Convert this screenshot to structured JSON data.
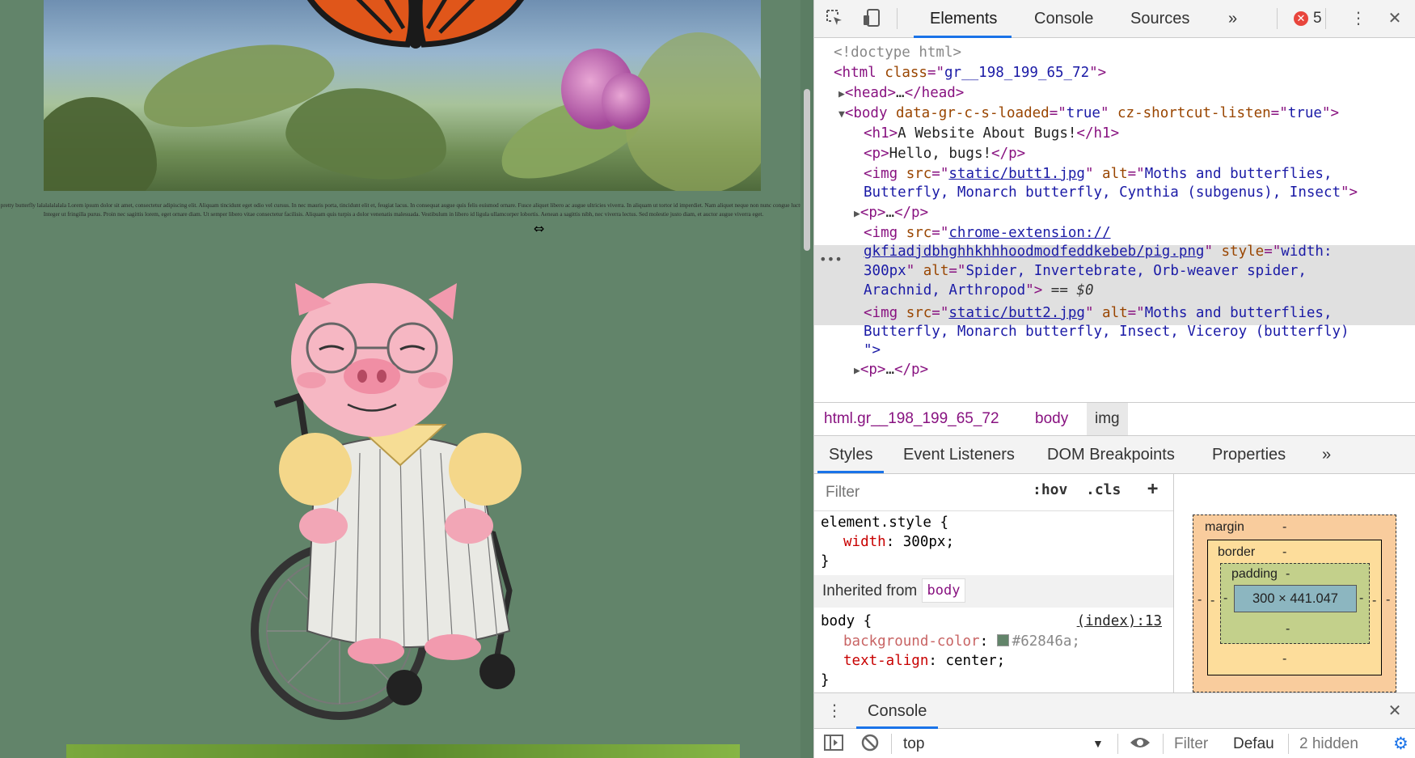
{
  "page": {
    "lorem_text": "pretty butterfly lalalalalalala Lorem ipsum dolor sit amet, consectetur adipiscing elit. Aliquam tincidunt eget odio vel cursus. In nec mauris porta, tincidunt elit et, feugiat lacus. In consequat augue quis felis euismod ornare. Fusce aliquet libero ac augue ultricies viverra. In aliquam ut tortor id imperdiet. Nam aliquet neque non nunc congue luctus. Integer ut fringilla purus. Proin nec sagittis lorem, eget ornare diam. Ut semper libero vitae consectetur facilisis. Aliquam quis turpis a dolor venenatis malesuada. Vestibulum in libero id ligula ullamcorper lobortis. Aenean a sagittis nibh, nec viverra lectus. Sed molestie justo diam, et auctor augue viverra eget.",
    "background_color": "#62846a"
  },
  "devtools": {
    "toolbar": {
      "tabs": [
        "Elements",
        "Console",
        "Sources"
      ],
      "more": "»",
      "error_count": "5",
      "menu_icon": "kebab-icon",
      "close_icon": "close-icon"
    },
    "dom_tree": {
      "doctype": "<!doctype html>",
      "html_tag": "html",
      "html_class_attr": "class",
      "html_class_val": "gr__198_199_65_72",
      "head_text": "…",
      "body_attr1": "data-gr-c-s-loaded",
      "body_attr1_val": "true",
      "body_attr2": "cz-shortcut-listen",
      "body_attr2_val": "true",
      "h1_text": "A Website About Bugs!",
      "p_text": "Hello, bugs!",
      "img1_src": "static/butt1.jpg",
      "img1_alt_line1": "Moths and butterflies,",
      "img1_alt_line2": "Butterfly, Monarch butterfly, Cynthia (subgenus), Insect",
      "p_collapsed": "…",
      "img2_src_line1": "chrome-extension://",
      "img2_src_line2": "gkfiadjdbhghhkhhhoodmodfeddkebeb/pig.png",
      "img2_style": "width:",
      "img2_style2": "300px",
      "img2_alt_line1": "Spider, Invertebrate, Orb-weaver spider,",
      "img2_alt_line2": "Arachnid, Arthropod",
      "selected_marker": "== $0",
      "img3_src": "static/butt2.jpg",
      "img3_alt_line1": "Moths and butterflies,",
      "img3_alt_line2": "Butterfly, Monarch butterfly, Insect, Viceroy (butterfly)",
      "img3_alt_end": "\">"
    },
    "breadcrumb": [
      "html.gr__198_199_65_72",
      "body",
      "img"
    ],
    "sub_tabs": [
      "Styles",
      "Event Listeners",
      "DOM Breakpoints",
      "Properties"
    ],
    "sub_tabs_more": "»",
    "styles": {
      "filter_placeholder": "Filter",
      "hov": ":hov",
      "cls": ".cls",
      "add": "+",
      "element_style": "element.style {",
      "element_prop": "width",
      "element_val": "300px;",
      "close_brace": "}",
      "inherited_label": "Inherited from",
      "inherited_from": "body",
      "body_selector": "body {",
      "body_source": "(index):13",
      "prop_bg": "background-color",
      "val_bg": "#62846a;",
      "prop_align": "text-align",
      "val_align": "center;"
    },
    "box_model": {
      "margin_label": "margin",
      "border_label": "border",
      "padding_label": "padding",
      "dash": "-",
      "content_size": "300 × 441.047"
    },
    "drawer": {
      "tab": "Console",
      "context": "top",
      "filter": "Filter",
      "levels": "Defau",
      "hidden": "2 hidden"
    }
  }
}
